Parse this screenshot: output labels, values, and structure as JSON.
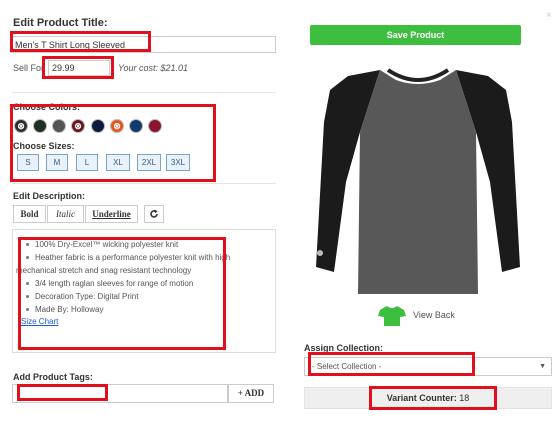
{
  "edit_title": {
    "heading": "Edit Product Title:",
    "value": "Men's T Shirt Long Sleeved"
  },
  "pricing": {
    "sell_for_label": "Sell For",
    "sell_for_value": "29.99",
    "your_cost": "Your cost: $21.01"
  },
  "colors": {
    "heading": "Choose Colors:",
    "swatches": [
      {
        "name": "charcoal",
        "hex": "#2e2e2e",
        "unavailable": true
      },
      {
        "name": "dark-green",
        "hex": "#1f2f22",
        "unavailable": false
      },
      {
        "name": "gray",
        "hex": "#545454",
        "unavailable": false
      },
      {
        "name": "maroon",
        "hex": "#6e1121",
        "unavailable": true
      },
      {
        "name": "navy",
        "hex": "#0e1a40",
        "unavailable": false
      },
      {
        "name": "orange",
        "hex": "#e8541c",
        "unavailable": true
      },
      {
        "name": "royal",
        "hex": "#12396f",
        "unavailable": false
      },
      {
        "name": "crimson",
        "hex": "#8b1530",
        "unavailable": false
      }
    ]
  },
  "sizes": {
    "heading": "Choose Sizes:",
    "options": [
      "S",
      "M",
      "L",
      "XL",
      "2XL",
      "3XL"
    ]
  },
  "description": {
    "heading": "Edit Description:",
    "toolbar": {
      "bold": "Bold",
      "italic": "Italic",
      "underline": "Underline",
      "refresh_icon": "refresh-icon"
    },
    "lines": [
      "100% Dry-Excel™ wicking polyester knit",
      "Heather fabric is a performance polyester knit with high",
      "mechanical stretch and snag resistant technology",
      "3/4 length raglan sleeves for range of motion",
      "Decoration Type: Digital Print",
      "Made By: Holloway"
    ],
    "link": "Size Chart"
  },
  "tags": {
    "heading": "Add Product Tags:",
    "value": "",
    "add_label": "+ ADD"
  },
  "preview": {
    "save_label": "Save Product",
    "view_back_label": "View Back",
    "shirt_body_color": "#585858",
    "shirt_sleeve_color": "#1b1b1b",
    "close_glyph": "×"
  },
  "collection": {
    "heading": "Assign Collection:",
    "selected": "- Select Collection -"
  },
  "variant_counter": {
    "label": "Variant Counter:",
    "value": "18"
  },
  "accent": {
    "highlight": "#e0101c",
    "save_green": "#3ebe3e",
    "link_blue": "#1a5fcc"
  }
}
